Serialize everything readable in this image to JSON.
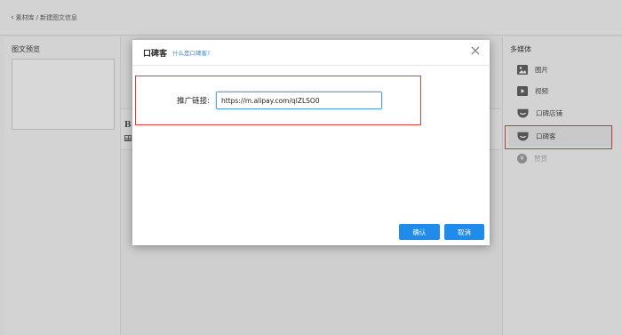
{
  "breadcrumb": {
    "back": "素材库",
    "separator": "/",
    "current": "新建图文信息"
  },
  "preview": {
    "title": "图文预览"
  },
  "media": {
    "title": "多媒体",
    "items": [
      {
        "label": "图片",
        "icon": "image-icon"
      },
      {
        "label": "视频",
        "icon": "video-icon"
      },
      {
        "label": "口碑店铺",
        "icon": "koubei-shop-icon"
      },
      {
        "label": "口碑客",
        "icon": "koubei-ke-icon"
      },
      {
        "label": "赞赏",
        "icon": "reward-icon"
      }
    ]
  },
  "editor": {
    "bold": "B"
  },
  "modal": {
    "title": "口碑客",
    "help_link": "什么是口碑客?",
    "close": "×",
    "promo_label": "推广链接:",
    "promo_value": "https://m.alipay.com/qlZLSO0",
    "confirm_label": "确认",
    "cancel_label": "取消"
  },
  "colors": {
    "primary": "#1f8ceb",
    "highlight": "#d9413a",
    "link": "#3a8be0"
  }
}
